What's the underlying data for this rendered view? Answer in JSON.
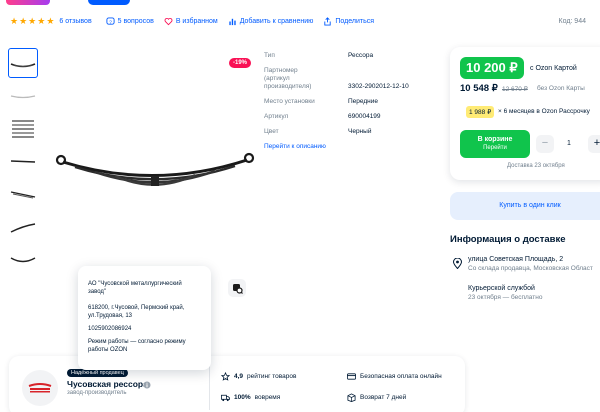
{
  "info_bar": {
    "rating_stars": 5,
    "reviews": "6 отзывов",
    "questions": "5 вопросов",
    "favorite": "В избранном",
    "compare": "Добавить к сравнению",
    "share": "Поделиться",
    "code": "Код: 944"
  },
  "gallery": {
    "thumb_count": 7,
    "discount": "-19%"
  },
  "specs": {
    "rows": [
      {
        "label": "Тип",
        "value": "Рессора"
      },
      {
        "label": "Партномер (артикул производителя)",
        "value": "3302-2902012-12-10"
      },
      {
        "label": "Место установки",
        "value": "Передние"
      },
      {
        "label": "Артикул",
        "value": "690004199"
      },
      {
        "label": "Цвет",
        "value": "Черный"
      }
    ],
    "more_link": "Перейти к описанию"
  },
  "price": {
    "card_price": "10 200 ₽",
    "card_note": "с Ozon Картой",
    "price": "10 548 ₽",
    "old_price": "12 670 ₽",
    "no_card_note": "без Ozon Карты",
    "installment": "1 988 ₽",
    "installment_note": "× 6 месяцев в Ozon Рассрочку",
    "cart_label": "В корзине",
    "cart_sub": "Перейти",
    "qty_minus": "−",
    "qty": "1",
    "qty_plus": "+",
    "delivery_date": "Доставка 23 октября",
    "one_click": "Купить в один клик"
  },
  "delivery": {
    "title": "Информация о доставке",
    "address": "улица Советская Площадь, 2",
    "address_sub": "Со склада продавца, Московская Област",
    "courier": "Курьерской службой",
    "courier_sub": "23 октября — бесплатно"
  },
  "seller_tooltip": {
    "company": "АО \"Чусовской металлургический завод\"",
    "address": "618200, г.Чусовой, Пермский край, ул.Трудовая, 13",
    "ogrn": "1025902086924",
    "schedule": "Режим работы — согласно режиму работы OZON"
  },
  "seller": {
    "badge": "Надёжный продавец",
    "name": "Чусовская рессора",
    "sub": "завод-производитель",
    "stats": {
      "rating_value": "4,9",
      "rating_label": "рейтинг товаров",
      "ontime_value": "100%",
      "ontime_label": "вовремя",
      "payment": "Безопасная оплата онлайн",
      "returns": "Возврат 7 дней"
    }
  },
  "colors": {
    "accent": "#005bff",
    "green": "#10c44c",
    "discount": "#f91155",
    "star": "#ffa800"
  }
}
